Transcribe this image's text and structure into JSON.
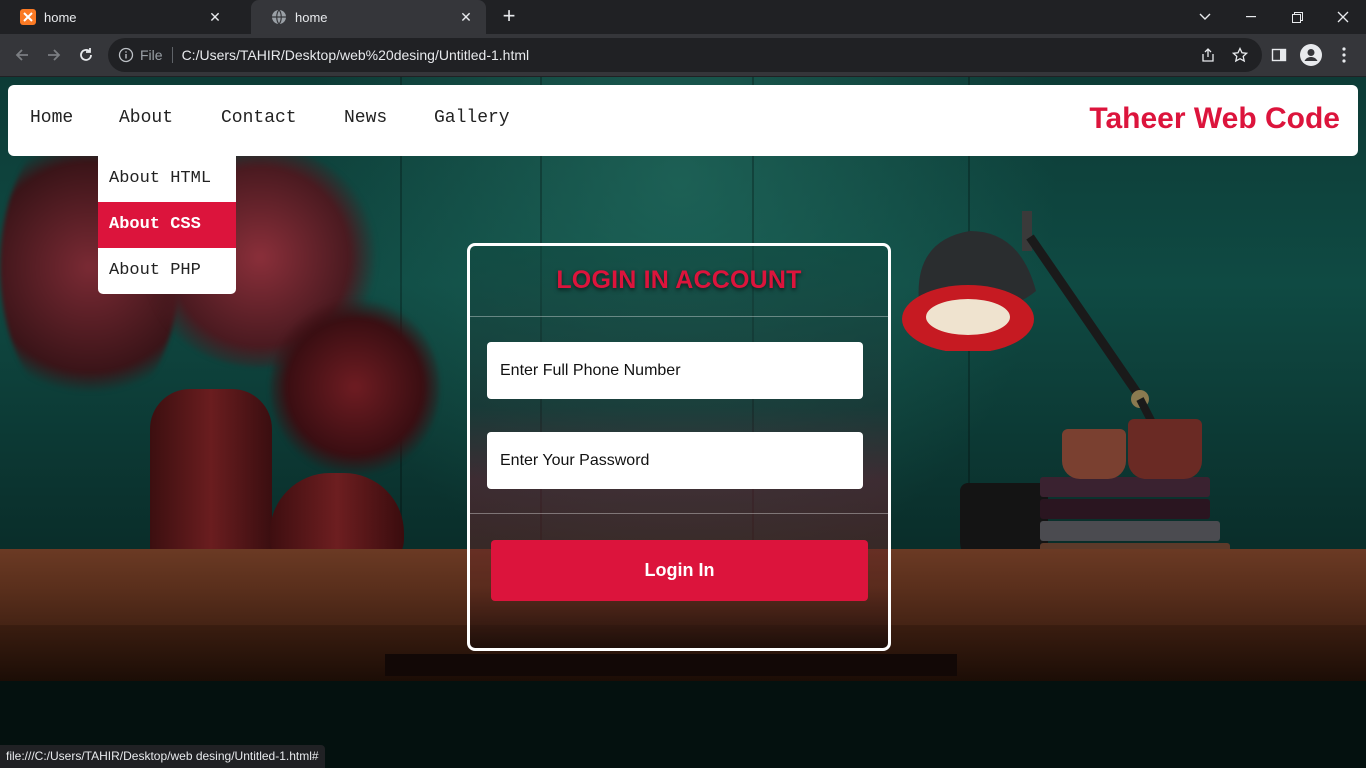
{
  "browser": {
    "tabs": [
      {
        "title": "home",
        "active": false
      },
      {
        "title": "home",
        "active": true
      }
    ],
    "new_tab_glyph": "+",
    "window_controls": [
      "chevron-down-icon",
      "minimize-icon",
      "restore-icon",
      "close-icon"
    ],
    "address": {
      "scheme_label": "File",
      "url": "C:/Users/TAHIR/Desktop/web%20desing/Untitled-1.html"
    },
    "status_text": "file:///C:/Users/TAHIR/Desktop/web desing/Untitled-1.html#"
  },
  "page": {
    "nav": {
      "items": [
        "Home",
        "About",
        "Contact",
        "News",
        "Gallery"
      ],
      "brand": "Taheer Web Code"
    },
    "dropdown": {
      "items": [
        "About HTML",
        "About CSS",
        "About PHP"
      ],
      "active_index": 1
    },
    "login": {
      "title": "LOGIN IN ACCOUNT",
      "phone_placeholder": "Enter Full Phone Number",
      "password_placeholder": "Enter Your Password",
      "button_label": "Login In"
    },
    "colors": {
      "accent": "#dc143c",
      "nav_bg": "#ffffff"
    }
  }
}
